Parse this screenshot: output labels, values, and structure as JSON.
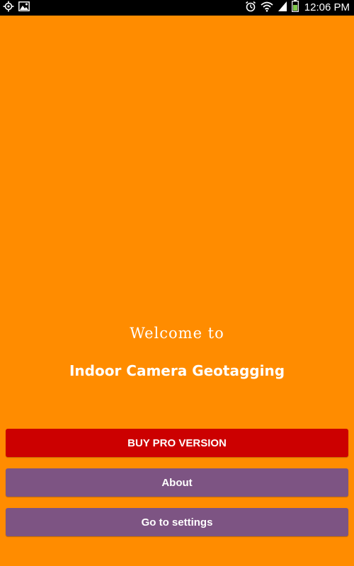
{
  "status_bar": {
    "time": "12:06 PM",
    "icons_left": [
      "gps-icon",
      "image-icon"
    ],
    "icons_right": [
      "alarm-icon",
      "wifi-icon",
      "signal-icon",
      "battery-icon"
    ]
  },
  "main": {
    "background_color": "#ff8c00",
    "welcome_text": "Welcome to",
    "app_name": "Indoor Camera Geotagging"
  },
  "buttons": {
    "buy_pro": {
      "label": "BUY PRO VERSION",
      "color": "#cc0000"
    },
    "about": {
      "label": "About",
      "color": "#7d5483"
    },
    "settings": {
      "label": "Go to settings",
      "color": "#7d5483"
    }
  }
}
